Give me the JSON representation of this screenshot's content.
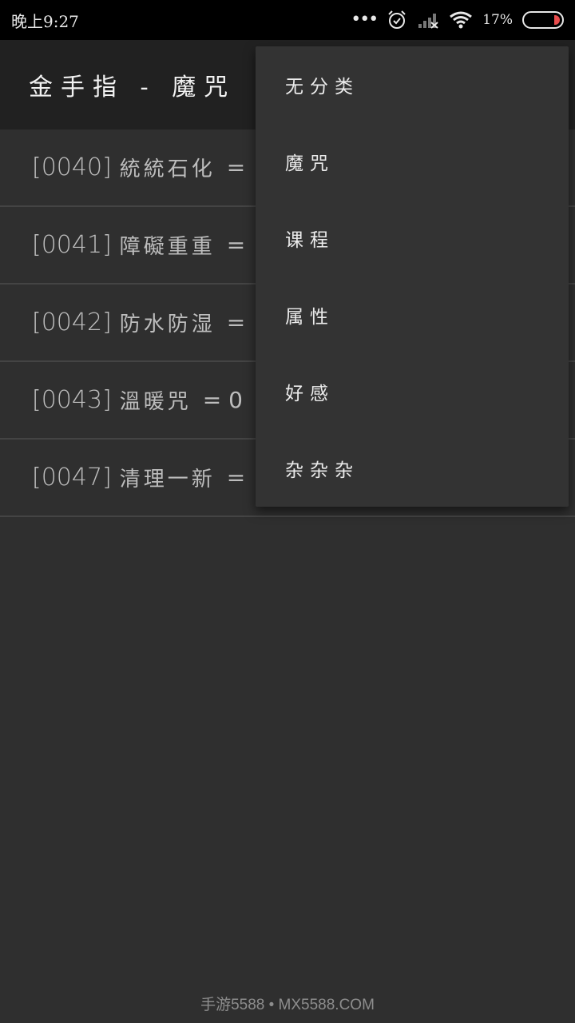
{
  "status_bar": {
    "time": "晚上9:27",
    "dots": "•••",
    "battery_percent": "17%",
    "battery_color": "#e84c4c"
  },
  "app_bar": {
    "title": "金手指 - 魔咒"
  },
  "list": {
    "items": [
      {
        "code": "[0040]",
        "name": "統統石化",
        "value": "="
      },
      {
        "code": "[0041]",
        "name": "障礙重重",
        "value": "="
      },
      {
        "code": "[0042]",
        "name": "防水防湿",
        "value": "="
      },
      {
        "code": "[0043]",
        "name": "溫暖咒",
        "value": "= 0"
      },
      {
        "code": "[0047]",
        "name": "清理一新",
        "value": "="
      }
    ]
  },
  "menu": {
    "items": [
      {
        "label": "无分类"
      },
      {
        "label": "魔咒"
      },
      {
        "label": "课程"
      },
      {
        "label": "属性"
      },
      {
        "label": "好感"
      },
      {
        "label": "杂杂杂"
      }
    ]
  },
  "watermark": {
    "text": "手游5588 • MX5588.COM"
  },
  "colors": {
    "background": "#2f2f2f",
    "app_bar": "#212121",
    "menu": "#333333",
    "divider": "#444444"
  }
}
